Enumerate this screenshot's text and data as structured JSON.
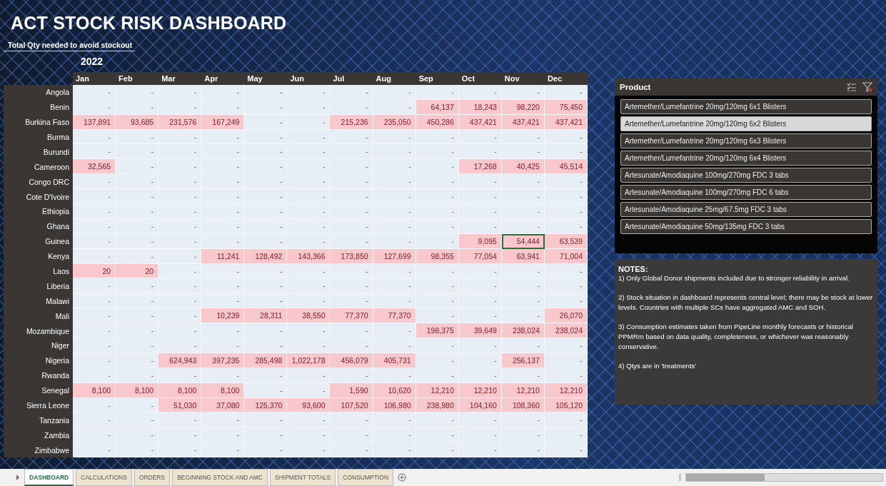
{
  "title": "ACT STOCK RISK DASHBOARD",
  "subtitle": "Total Qty needed to avoid stockout",
  "year": "2022",
  "table": {
    "columns": [
      "Jan",
      "Feb",
      "Mar",
      "Apr",
      "May",
      "Jun",
      "Jul",
      "Aug",
      "Sep",
      "Oct",
      "Nov",
      "Dec"
    ],
    "rows": [
      {
        "country": "Angola",
        "values": [
          "-",
          "-",
          "-",
          "-",
          "-",
          "-",
          "-",
          "-",
          "-",
          "-",
          "-",
          "-"
        ],
        "risk": [
          false,
          false,
          false,
          false,
          false,
          false,
          false,
          false,
          false,
          false,
          false,
          false
        ],
        "selected": [
          false,
          false,
          false,
          false,
          false,
          false,
          false,
          false,
          false,
          false,
          false,
          false
        ]
      },
      {
        "country": "Benin",
        "values": [
          "-",
          "-",
          "-",
          "-",
          "-",
          "-",
          "-",
          "-",
          "64,137",
          "18,243",
          "98,220",
          "75,450"
        ],
        "risk": [
          false,
          false,
          false,
          false,
          false,
          false,
          false,
          false,
          true,
          true,
          true,
          true
        ],
        "selected": [
          false,
          false,
          false,
          false,
          false,
          false,
          false,
          false,
          false,
          false,
          false,
          false
        ]
      },
      {
        "country": "Burkina Faso",
        "values": [
          "137,891",
          "93,685",
          "231,576",
          "167,249",
          "-",
          "-",
          "215,236",
          "235,050",
          "450,286",
          "437,421",
          "437,421",
          "437,421"
        ],
        "risk": [
          true,
          true,
          true,
          true,
          false,
          false,
          true,
          true,
          true,
          true,
          true,
          true
        ],
        "selected": [
          false,
          false,
          false,
          false,
          false,
          false,
          false,
          false,
          false,
          false,
          false,
          false
        ]
      },
      {
        "country": "Burma",
        "values": [
          "-",
          "-",
          "-",
          "-",
          "-",
          "-",
          "-",
          "-",
          "-",
          "-",
          "-",
          "-"
        ],
        "risk": [
          false,
          false,
          false,
          false,
          false,
          false,
          false,
          false,
          false,
          false,
          false,
          false
        ],
        "selected": [
          false,
          false,
          false,
          false,
          false,
          false,
          false,
          false,
          false,
          false,
          false,
          false
        ]
      },
      {
        "country": "Burundi",
        "values": [
          "-",
          "-",
          "-",
          "-",
          "-",
          "-",
          "-",
          "-",
          "-",
          "-",
          "-",
          "-"
        ],
        "risk": [
          false,
          false,
          false,
          false,
          false,
          false,
          false,
          false,
          false,
          false,
          false,
          false
        ],
        "selected": [
          false,
          false,
          false,
          false,
          false,
          false,
          false,
          false,
          false,
          false,
          false,
          false
        ]
      },
      {
        "country": "Cameroon",
        "values": [
          "32,565",
          "-",
          "-",
          "-",
          "-",
          "-",
          "-",
          "-",
          "-",
          "17,268",
          "40,425",
          "45,514"
        ],
        "risk": [
          true,
          false,
          false,
          false,
          false,
          false,
          false,
          false,
          false,
          true,
          true,
          true
        ],
        "selected": [
          false,
          false,
          false,
          false,
          false,
          false,
          false,
          false,
          false,
          false,
          false,
          false
        ]
      },
      {
        "country": "Congo DRC",
        "values": [
          "-",
          "-",
          "-",
          "-",
          "-",
          "-",
          "-",
          "-",
          "-",
          "-",
          "-",
          "-"
        ],
        "risk": [
          false,
          false,
          false,
          false,
          false,
          false,
          false,
          false,
          false,
          false,
          false,
          false
        ],
        "selected": [
          false,
          false,
          false,
          false,
          false,
          false,
          false,
          false,
          false,
          false,
          false,
          false
        ]
      },
      {
        "country": "Cote D'Ivoire",
        "values": [
          "-",
          "-",
          "-",
          "-",
          "-",
          "-",
          "-",
          "-",
          "-",
          "-",
          "-",
          "-"
        ],
        "risk": [
          false,
          false,
          false,
          false,
          false,
          false,
          false,
          false,
          false,
          false,
          false,
          false
        ],
        "selected": [
          false,
          false,
          false,
          false,
          false,
          false,
          false,
          false,
          false,
          false,
          false,
          false
        ]
      },
      {
        "country": "Ethiopia",
        "values": [
          "-",
          "-",
          "-",
          "-",
          "-",
          "-",
          "-",
          "-",
          "-",
          "-",
          "-",
          "-"
        ],
        "risk": [
          false,
          false,
          false,
          false,
          false,
          false,
          false,
          false,
          false,
          false,
          false,
          false
        ],
        "selected": [
          false,
          false,
          false,
          false,
          false,
          false,
          false,
          false,
          false,
          false,
          false,
          false
        ]
      },
      {
        "country": "Ghana",
        "values": [
          "-",
          "-",
          "-",
          "-",
          "-",
          "-",
          "-",
          "-",
          "-",
          "-",
          "-",
          "-"
        ],
        "risk": [
          false,
          false,
          false,
          false,
          false,
          false,
          false,
          false,
          false,
          false,
          false,
          false
        ],
        "selected": [
          false,
          false,
          false,
          false,
          false,
          false,
          false,
          false,
          false,
          false,
          false,
          false
        ]
      },
      {
        "country": "Guinea",
        "values": [
          "-",
          "-",
          "-",
          "-",
          "-",
          "-",
          "-",
          "-",
          "-",
          "9,095",
          "54,444",
          "63,539"
        ],
        "risk": [
          false,
          false,
          false,
          false,
          false,
          false,
          false,
          false,
          false,
          true,
          true,
          true
        ],
        "selected": [
          false,
          false,
          false,
          false,
          false,
          false,
          false,
          false,
          false,
          false,
          true,
          false
        ]
      },
      {
        "country": "Kenya",
        "values": [
          "-",
          "-",
          "-",
          "11,241",
          "128,492",
          "143,366",
          "173,850",
          "127,699",
          "98,355",
          "77,054",
          "63,941",
          "71,004"
        ],
        "risk": [
          false,
          false,
          false,
          true,
          true,
          true,
          true,
          true,
          true,
          true,
          true,
          true
        ],
        "selected": [
          false,
          false,
          false,
          false,
          false,
          false,
          false,
          false,
          false,
          false,
          false,
          false
        ]
      },
      {
        "country": "Laos",
        "values": [
          "20",
          "20",
          "-",
          "-",
          "-",
          "-",
          "-",
          "-",
          "-",
          "-",
          "-",
          "-"
        ],
        "risk": [
          true,
          true,
          false,
          false,
          false,
          false,
          false,
          false,
          false,
          false,
          false,
          false
        ],
        "selected": [
          false,
          false,
          false,
          false,
          false,
          false,
          false,
          false,
          false,
          false,
          false,
          false
        ]
      },
      {
        "country": "Liberia",
        "values": [
          "-",
          "-",
          "-",
          "-",
          "-",
          "-",
          "-",
          "-",
          "-",
          "-",
          "-",
          "-"
        ],
        "risk": [
          false,
          false,
          false,
          false,
          false,
          false,
          false,
          false,
          false,
          false,
          false,
          false
        ],
        "selected": [
          false,
          false,
          false,
          false,
          false,
          false,
          false,
          false,
          false,
          false,
          false,
          false
        ]
      },
      {
        "country": "Malawi",
        "values": [
          "-",
          "-",
          "-",
          "-",
          "-",
          "-",
          "-",
          "-",
          "-",
          "-",
          "-",
          "-"
        ],
        "risk": [
          false,
          false,
          false,
          false,
          false,
          false,
          false,
          false,
          false,
          false,
          false,
          false
        ],
        "selected": [
          false,
          false,
          false,
          false,
          false,
          false,
          false,
          false,
          false,
          false,
          false,
          false
        ]
      },
      {
        "country": "Mali",
        "values": [
          "-",
          "-",
          "-",
          "10,239",
          "28,311",
          "38,550",
          "77,370",
          "77,370",
          "-",
          "-",
          "-",
          "26,070"
        ],
        "risk": [
          false,
          false,
          false,
          true,
          true,
          true,
          true,
          true,
          false,
          false,
          false,
          true
        ],
        "selected": [
          false,
          false,
          false,
          false,
          false,
          false,
          false,
          false,
          false,
          false,
          false,
          false
        ]
      },
      {
        "country": "Mozambique",
        "values": [
          "-",
          "-",
          "-",
          "-",
          "-",
          "-",
          "-",
          "-",
          "198,375",
          "39,649",
          "238,024",
          "238,024"
        ],
        "risk": [
          false,
          false,
          false,
          false,
          false,
          false,
          false,
          false,
          true,
          true,
          true,
          true
        ],
        "selected": [
          false,
          false,
          false,
          false,
          false,
          false,
          false,
          false,
          false,
          false,
          false,
          false
        ]
      },
      {
        "country": "Niger",
        "values": [
          "-",
          "-",
          "-",
          "-",
          "-",
          "-",
          "-",
          "-",
          "-",
          "-",
          "-",
          "-"
        ],
        "risk": [
          false,
          false,
          false,
          false,
          false,
          false,
          false,
          false,
          false,
          false,
          false,
          false
        ],
        "selected": [
          false,
          false,
          false,
          false,
          false,
          false,
          false,
          false,
          false,
          false,
          false,
          false
        ]
      },
      {
        "country": "Nigeria",
        "values": [
          "-",
          "-",
          "624,943",
          "397,235",
          "285,498",
          "1,022,178",
          "456,079",
          "405,731",
          "-",
          "-",
          "256,137",
          "-"
        ],
        "risk": [
          false,
          false,
          true,
          true,
          true,
          true,
          true,
          true,
          false,
          false,
          true,
          false
        ],
        "selected": [
          false,
          false,
          false,
          false,
          false,
          false,
          false,
          false,
          false,
          false,
          false,
          false
        ]
      },
      {
        "country": "Rwanda",
        "values": [
          "-",
          "-",
          "-",
          "-",
          "-",
          "-",
          "-",
          "-",
          "-",
          "-",
          "-",
          "-"
        ],
        "risk": [
          false,
          false,
          false,
          false,
          false,
          false,
          false,
          false,
          false,
          false,
          false,
          false
        ],
        "selected": [
          false,
          false,
          false,
          false,
          false,
          false,
          false,
          false,
          false,
          false,
          false,
          false
        ]
      },
      {
        "country": "Senegal",
        "values": [
          "8,100",
          "8,100",
          "8,100",
          "8,100",
          "-",
          "-",
          "1,590",
          "10,620",
          "12,210",
          "12,210",
          "12,210",
          "12,210"
        ],
        "risk": [
          true,
          true,
          true,
          true,
          false,
          false,
          true,
          true,
          true,
          true,
          true,
          true
        ],
        "selected": [
          false,
          false,
          false,
          false,
          false,
          false,
          false,
          false,
          false,
          false,
          false,
          false
        ]
      },
      {
        "country": "Sierra Leone",
        "values": [
          "-",
          "-",
          "51,030",
          "37,080",
          "125,370",
          "93,600",
          "107,520",
          "106,980",
          "238,980",
          "104,160",
          "108,360",
          "105,120"
        ],
        "risk": [
          false,
          false,
          true,
          true,
          true,
          true,
          true,
          true,
          true,
          true,
          true,
          true
        ],
        "selected": [
          false,
          false,
          false,
          false,
          false,
          false,
          false,
          false,
          false,
          false,
          false,
          false
        ]
      },
      {
        "country": "Tanzania",
        "values": [
          "-",
          "-",
          "-",
          "-",
          "-",
          "-",
          "-",
          "-",
          "-",
          "-",
          "-",
          "-"
        ],
        "risk": [
          false,
          false,
          false,
          false,
          false,
          false,
          false,
          false,
          false,
          false,
          false,
          false
        ],
        "selected": [
          false,
          false,
          false,
          false,
          false,
          false,
          false,
          false,
          false,
          false,
          false,
          false
        ]
      },
      {
        "country": "Zambia",
        "values": [
          "-",
          "-",
          "-",
          "-",
          "-",
          "-",
          "-",
          "-",
          "-",
          "-",
          "-",
          "-"
        ],
        "risk": [
          false,
          false,
          false,
          false,
          false,
          false,
          false,
          false,
          false,
          false,
          false,
          false
        ],
        "selected": [
          false,
          false,
          false,
          false,
          false,
          false,
          false,
          false,
          false,
          false,
          false,
          false
        ]
      },
      {
        "country": "Zimbabwe",
        "values": [
          "-",
          "-",
          "-",
          "-",
          "-",
          "-",
          "-",
          "-",
          "-",
          "-",
          "-",
          "-"
        ],
        "risk": [
          false,
          false,
          false,
          false,
          false,
          false,
          false,
          false,
          false,
          false,
          false,
          false
        ],
        "selected": [
          false,
          false,
          false,
          false,
          false,
          false,
          false,
          false,
          false,
          false,
          false,
          false
        ]
      }
    ]
  },
  "slicer": {
    "title": "Product",
    "items": [
      {
        "label": "Artemether/Lumefantrine 20mg/120mg 6x1 Blisters",
        "selected": false
      },
      {
        "label": "Artemether/Lumefantrine 20mg/120mg 6x2 Blisters",
        "selected": true
      },
      {
        "label": "Artemether/Lumefantrine 20mg/120mg 6x3 Blisters",
        "selected": false
      },
      {
        "label": "Artemether/Lumefantrine 20mg/120mg 6x4 Blisters",
        "selected": false
      },
      {
        "label": "Artesunate/Amodiaquine 100mg/270mg FDC 3 tabs",
        "selected": false
      },
      {
        "label": "Artesunate/Amodiaquine 100mg/270mg FDC 6 tabs",
        "selected": false
      },
      {
        "label": "Artesunate/Amodiaquine 25mg/67.5mg FDC 3 tabs",
        "selected": false
      },
      {
        "label": "Artesunate/Amodiaquine 50mg/135mg FDC 3 tabs",
        "selected": false
      }
    ]
  },
  "notes": {
    "heading": "NOTES:",
    "items": [
      "1) Only Global Donor shipments included due to stronger reliability in arrival.",
      "2) Stock situation in dashboard represents central level; there may be stock at lower levels. Countries with multiple SCs have aggregated AMC and SOH.",
      "3) Consumption estimates taken from PipeLine monthly forecasts or historical PPMRm based on data quality, completeness, or whichever was reasonably conservative.",
      "4) Qtys are in 'treatments'"
    ]
  },
  "sheet_tabs": [
    {
      "label": "DASHBOARD",
      "selected": true
    },
    {
      "label": "CALCULATIONS",
      "selected": false
    },
    {
      "label": "ORDERS",
      "selected": false
    },
    {
      "label": "BEGINNING STOCK AND AMC",
      "selected": false
    },
    {
      "label": "SHIPMENT TOTALS",
      "selected": false
    },
    {
      "label": "CONSUMPTION",
      "selected": false
    }
  ]
}
